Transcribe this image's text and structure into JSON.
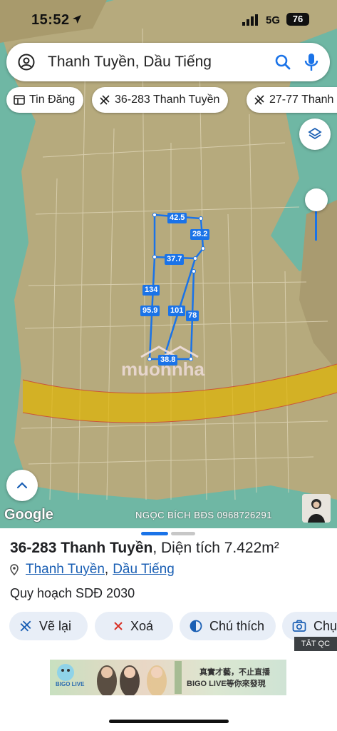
{
  "status_bar": {
    "time": "15:52",
    "network": "5G",
    "battery": "76"
  },
  "search": {
    "query": "Thanh Tuyền, Dầu Tiếng"
  },
  "chips": [
    {
      "label": "Tin Đăng",
      "icon": "listing-icon"
    },
    {
      "label": "36-283 Thanh Tuyền",
      "icon": "parcel-icon"
    },
    {
      "label": "27-77 Thanh",
      "icon": "parcel-icon"
    }
  ],
  "map": {
    "measurements": [
      "42.5",
      "28.2",
      "37.7",
      "134",
      "95.9",
      "101",
      "78",
      "38.8"
    ],
    "attribution": "Google",
    "watermark_text": "NGỌC BÍCH BĐS 0968726291"
  },
  "sheet": {
    "title_bold": "36-283 Thanh Tuyền",
    "title_rest": ", Diện tích 7.422m²",
    "location_1": "Thanh Tuyền",
    "location_sep": ",",
    "location_2": "Dầu Tiếng",
    "plan": "Quy hoạch SDĐ 2030",
    "actions": [
      {
        "label": "Vẽ lại",
        "icon": "redraw-icon"
      },
      {
        "label": "Xoá",
        "icon": "close-icon"
      },
      {
        "label": "Chú thích",
        "icon": "legend-icon"
      },
      {
        "label": "Chụp",
        "icon": "camera-icon"
      }
    ],
    "ad_badge": "TẮT QC",
    "ad": {
      "line1": "真實才藝，不止直播",
      "line2": "BIGO LIVE等你來發現",
      "brand": "BIGO LIVE"
    }
  },
  "colors": {
    "accent": "#1a73e8",
    "zone": "#e0b400",
    "water": "#6fb7a4",
    "land": "#b7a77a"
  }
}
